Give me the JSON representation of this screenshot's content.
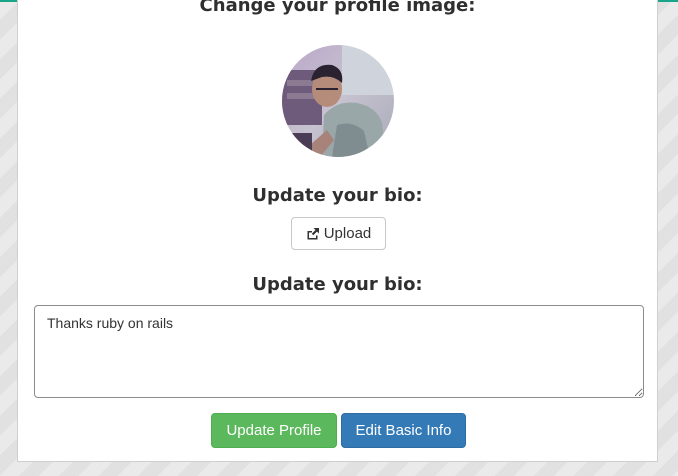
{
  "profile_image_section": {
    "heading": "Change your profile image:"
  },
  "upload_section": {
    "heading": "Update your bio:",
    "upload_button_label": "Upload",
    "upload_icon": "share-square-icon"
  },
  "bio_section": {
    "heading": "Update your bio:",
    "bio_value": "Thanks ruby on rails"
  },
  "actions": {
    "update_profile_label": "Update Profile",
    "edit_basic_info_label": "Edit Basic Info"
  },
  "colors": {
    "accent_top": "#1aa58a",
    "success": "#5cb85c",
    "primary": "#337ab7"
  }
}
